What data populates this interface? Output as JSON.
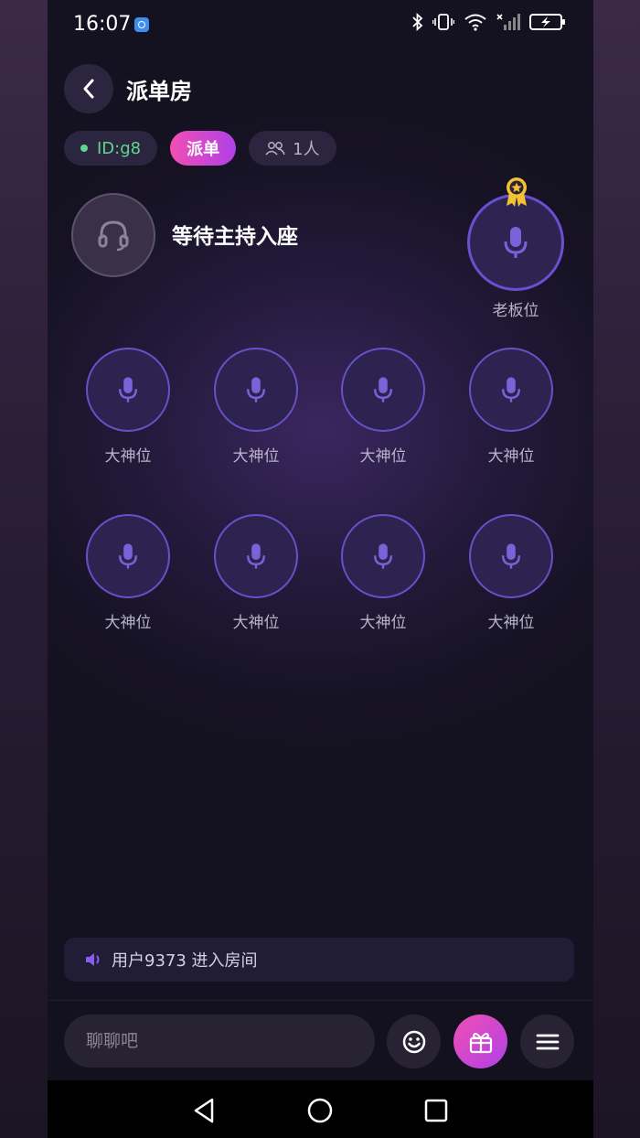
{
  "status_bar": {
    "time": "16:07"
  },
  "header": {
    "title": "派单房"
  },
  "tags": {
    "room_id": "ID:g8",
    "dispatch": "派单",
    "online_count": "1人"
  },
  "host": {
    "status": "等待主持入座"
  },
  "boss_seat": {
    "label": "老板位"
  },
  "seats": [
    {
      "label": "大神位"
    },
    {
      "label": "大神位"
    },
    {
      "label": "大神位"
    },
    {
      "label": "大神位"
    },
    {
      "label": "大神位"
    },
    {
      "label": "大神位"
    },
    {
      "label": "大神位"
    },
    {
      "label": "大神位"
    }
  ],
  "notice": {
    "text": "用户9373 进入房间"
  },
  "chat": {
    "placeholder": "聊聊吧"
  },
  "colors": {
    "accent_purple": "#6a50c8",
    "gift_gradient_start": "#f04fb3",
    "gift_gradient_end": "#b040e8",
    "online_green": "#5fd68a"
  },
  "icons": [
    "back-arrow-icon",
    "headset-icon",
    "microphone-icon",
    "medal-icon",
    "speaker-icon",
    "emoji-icon",
    "gift-icon",
    "menu-icon",
    "people-icon"
  ]
}
